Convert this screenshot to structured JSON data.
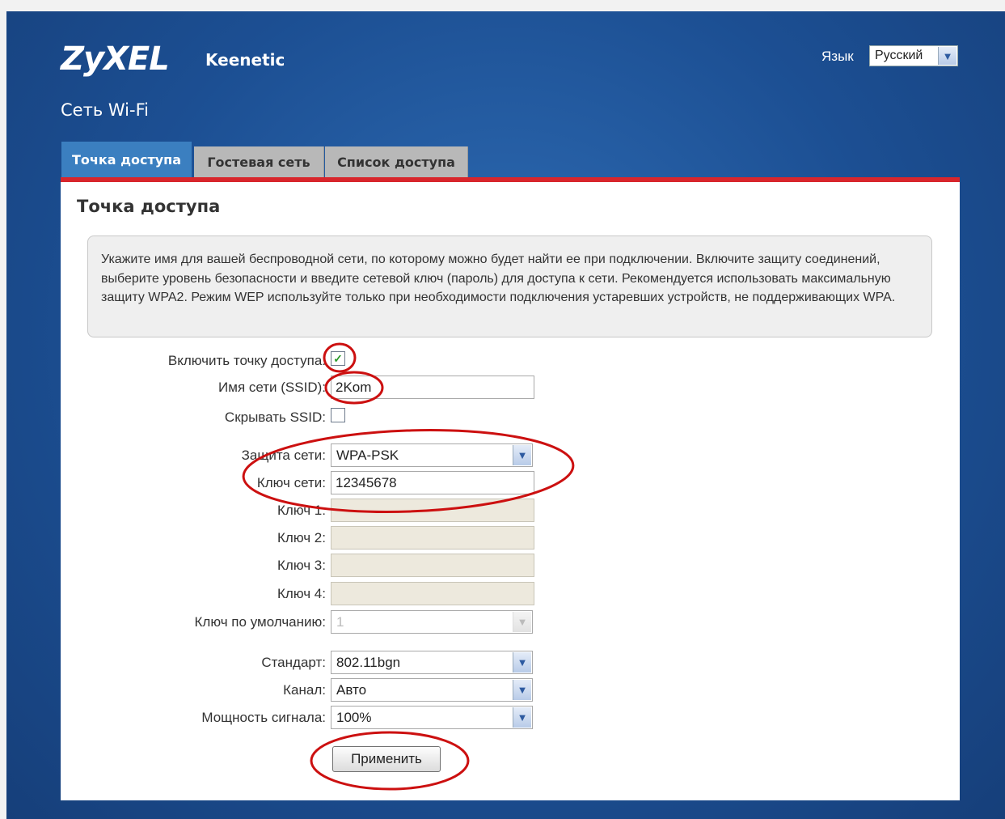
{
  "header": {
    "logo": "ZyXEL",
    "product": "Keenetic",
    "page_title": "Сеть Wi-Fi",
    "language_label": "Язык",
    "language_value": "Русский"
  },
  "tabs": [
    {
      "label": "Точка доступа",
      "active": true
    },
    {
      "label": "Гостевая сеть",
      "active": false
    },
    {
      "label": "Список доступа",
      "active": false
    }
  ],
  "section_title": "Точка доступа",
  "info_text": "Укажите имя для вашей беспроводной сети, по которому можно будет найти ее при подключении. Включите защиту соединений, выберите уровень безопасности и введите сетевой ключ (пароль) для доступа к сети. Рекомендуется использовать максимальную защиту WPA2. Режим WEP используйте только при необходимости подключения устаревших устройств, не поддерживающих WPA.",
  "form": {
    "enable_ap": {
      "label": "Включить точку доступа:",
      "checked": true,
      "mark": "✓"
    },
    "ssid": {
      "label": "Имя сети (SSID):",
      "value": "2Kom"
    },
    "hide_ssid": {
      "label": "Скрывать SSID:",
      "checked": false
    },
    "security": {
      "label": "Защита сети:",
      "value": "WPA-PSK"
    },
    "network_key": {
      "label": "Ключ сети:",
      "value": "12345678"
    },
    "key1": {
      "label": "Ключ 1:",
      "value": ""
    },
    "key2": {
      "label": "Ключ 2:",
      "value": ""
    },
    "key3": {
      "label": "Ключ 3:",
      "value": ""
    },
    "key4": {
      "label": "Ключ 4:",
      "value": ""
    },
    "default_key": {
      "label": "Ключ по умолчанию:",
      "value": "1"
    },
    "standard": {
      "label": "Стандарт:",
      "value": "802.11bgn"
    },
    "channel": {
      "label": "Канал:",
      "value": "Авто"
    },
    "power": {
      "label": "Мощность сигнала:",
      "value": "100%"
    },
    "apply_label": "Применить"
  },
  "icons": {
    "dropdown": "chevron-down-icon",
    "check": "checkmark-icon"
  },
  "colors": {
    "accent_red": "#d8262c",
    "background_blue": "#1c4f93",
    "active_tab": "#3b7fc0",
    "annotation": "#cc1010"
  }
}
